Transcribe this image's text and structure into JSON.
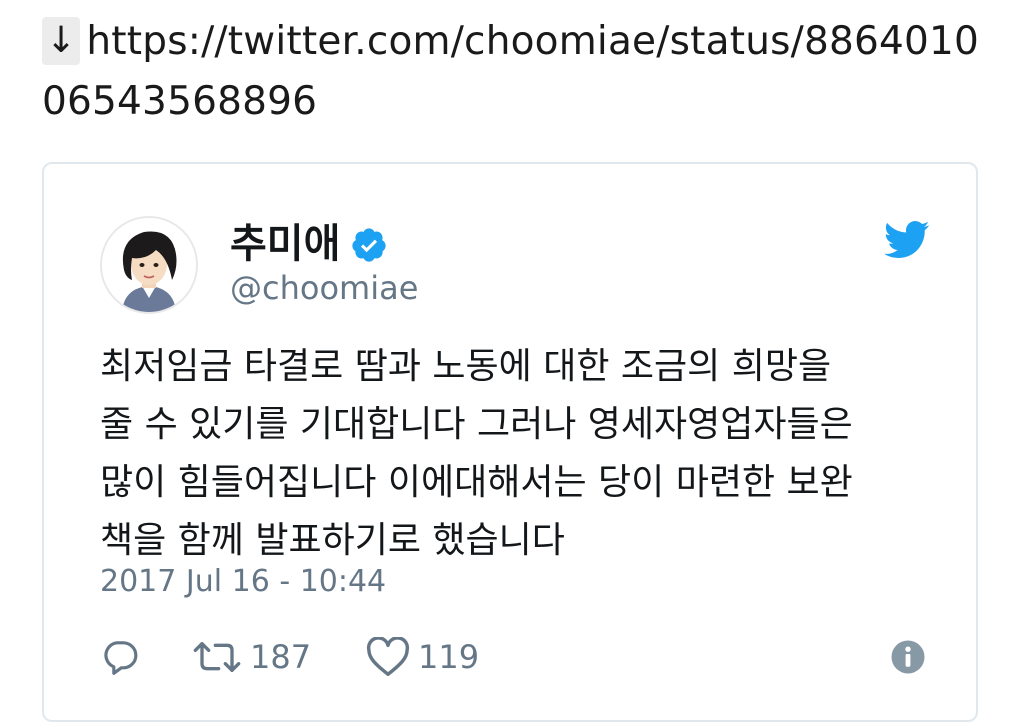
{
  "link": {
    "arrow": "↓",
    "url": "https://twitter.com/choomiae/status/886401006543568896"
  },
  "tweet": {
    "display_name": "추미애",
    "handle": "@choomiae",
    "text": "최저임금 타결로 땀과 노동에 대한 조금의 희망을\n줄 수 있기를 기대합니다 그러나 영세자영업자들은\n많이 힘들어집니다 이에대해서는 당이 마련한 보완\n책을 함께 발표하기로 했습니다",
    "timestamp": "2017 Jul 16 - 10:44",
    "retweet_count": "187",
    "like_count": "119"
  },
  "icons": {
    "verified": "verified-badge-icon",
    "brand": "twitter-bird-icon",
    "reply": "reply-icon",
    "retweet": "retweet-icon",
    "like": "heart-icon",
    "info": "info-icon"
  },
  "colors": {
    "twitter_blue": "#1da1f2",
    "muted_text": "#657786",
    "card_border": "#e1e8ed",
    "info_icon": "#8899a6"
  }
}
